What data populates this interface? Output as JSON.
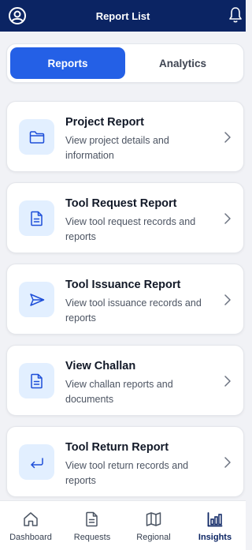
{
  "header": {
    "title": "Report List",
    "left_icon": "profile-icon",
    "right_icon": "bell-icon"
  },
  "tabs": [
    {
      "label": "Reports",
      "active": true
    },
    {
      "label": "Analytics",
      "active": false
    }
  ],
  "reports": [
    {
      "title": "Project Report",
      "description": "View project details and information",
      "icon": "folder-icon"
    },
    {
      "title": "Tool Request Report",
      "description": "View tool request records and reports",
      "icon": "document-icon"
    },
    {
      "title": "Tool Issuance Report",
      "description": "View tool issuance records and reports",
      "icon": "send-icon"
    },
    {
      "title": "View Challan",
      "description": "View challan reports and documents",
      "icon": "document-icon"
    },
    {
      "title": "Tool Return Report",
      "description": "View tool return records and reports",
      "icon": "return-arrow-icon"
    }
  ],
  "bottom_nav": [
    {
      "label": "Dashboard",
      "icon": "home-icon",
      "active": false
    },
    {
      "label": "Requests",
      "icon": "document-icon",
      "active": false
    },
    {
      "label": "Regional",
      "icon": "map-icon",
      "active": false
    },
    {
      "label": "Insights",
      "icon": "bar-chart-icon",
      "active": true
    }
  ],
  "colors": {
    "header_bg": "#0b2463",
    "accent": "#2460e6",
    "icon_bg": "#e2efff",
    "icon_stroke": "#1d4ed8",
    "page_bg": "#f1f2f6"
  }
}
